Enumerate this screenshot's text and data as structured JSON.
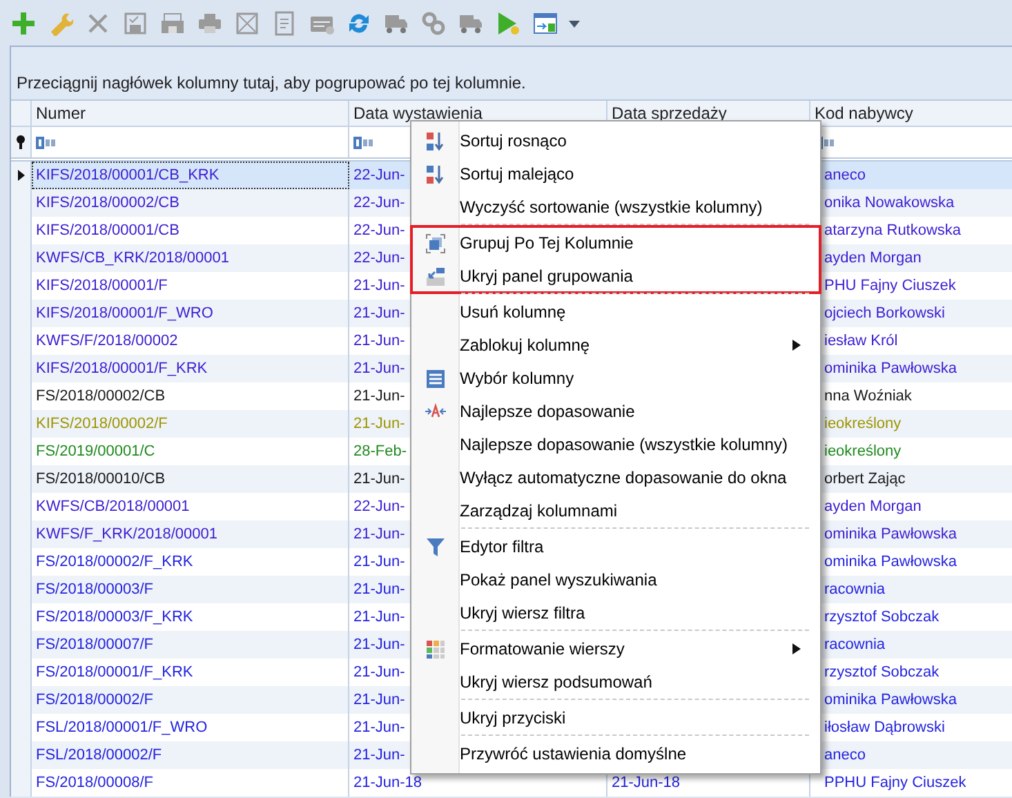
{
  "toolbar": [
    {
      "kind": "add",
      "disabled": false
    },
    {
      "kind": "edit",
      "disabled": false
    },
    {
      "kind": "delete",
      "disabled": true
    },
    {
      "kind": "save",
      "disabled": true
    },
    {
      "kind": "saveall",
      "disabled": true
    },
    {
      "kind": "print",
      "disabled": true
    },
    {
      "kind": "cancel",
      "disabled": true
    },
    {
      "kind": "document",
      "disabled": true
    },
    {
      "kind": "card",
      "disabled": true
    },
    {
      "kind": "refresh",
      "disabled": false
    },
    {
      "kind": "truck",
      "disabled": true
    },
    {
      "kind": "gears",
      "disabled": true
    },
    {
      "kind": "truck",
      "disabled": true
    },
    {
      "kind": "run",
      "disabled": false
    },
    {
      "kind": "export",
      "disabled": false
    }
  ],
  "group_panel": {
    "hint": "Przeciągnij nagłówek kolumny tutaj, aby pogrupować po tej kolumnie."
  },
  "table": {
    "columns": [
      {
        "title": "Numer",
        "filter": true
      },
      {
        "title": "Data wystawienia",
        "filter": true
      },
      {
        "title": "Data sprzedaży"
      },
      {
        "title": "Kod nabywcy",
        "filter": true
      }
    ],
    "rows": [
      {
        "number": "KIFS/2018/00001/CB_KRK",
        "issued": "22-Jun-",
        "buyer": "aneco",
        "color": "#3b1ed2",
        "selected": true
      },
      {
        "number": "KIFS/2018/00002/CB",
        "issued": "22-Jun-",
        "buyer": "onika Nowakowska",
        "color": "#3b1ed2",
        "selected": false
      },
      {
        "number": "KIFS/2018/00001/CB",
        "issued": "22-Jun-",
        "buyer": "atarzyna Rutkowska",
        "color": "#3b1ed2",
        "selected": false
      },
      {
        "number": "KWFS/CB_KRK/2018/00001",
        "issued": "22-Jun-",
        "buyer": "ayden Morgan",
        "color": "#3b1ed2",
        "selected": false
      },
      {
        "number": "KIFS/2018/00001/F",
        "issued": "21-Jun-",
        "buyer": "PHU Fajny Ciuszek",
        "color": "#3b1ed2",
        "selected": false
      },
      {
        "number": "KIFS/2018/00001/F_WRO",
        "issued": "21-Jun-",
        "buyer": "ojciech Borkowski",
        "color": "#3b1ed2",
        "selected": false
      },
      {
        "number": "KWFS/F/2018/00002",
        "issued": "21-Jun-",
        "buyer": "iesław Król",
        "color": "#3b1ed2",
        "selected": false
      },
      {
        "number": "KIFS/2018/00001/F_KRK",
        "issued": "21-Jun-",
        "buyer": "ominika Pawłowska",
        "color": "#3b1ed2",
        "selected": false
      },
      {
        "number": "FS/2018/00002/CB",
        "issued": "21-Jun-",
        "buyer": "nna Woźniak",
        "color": "#1a1a1a",
        "selected": false
      },
      {
        "number": "KIFS/2018/00002/F",
        "issued": "21-Jun-",
        "buyer": "ieokreślony",
        "color": "#9c9600",
        "selected": false
      },
      {
        "number": "FS/2019/00001/C",
        "issued": "28-Feb-",
        "buyer": "ieokreślony",
        "color": "#1f8a1f",
        "selected": false
      },
      {
        "number": "FS/2018/00010/CB",
        "issued": "21-Jun-",
        "buyer": "orbert Zając",
        "color": "#1a1a1a",
        "selected": false
      },
      {
        "number": "KWFS/CB/2018/00001",
        "issued": "22-Jun-",
        "buyer": "ayden Morgan",
        "color": "#3b1ed2",
        "selected": false
      },
      {
        "number": "KWFS/F_KRK/2018/00001",
        "issued": "21-Jun-",
        "buyer": "ominika Pawłowska",
        "color": "#3b1ed2",
        "selected": false
      },
      {
        "number": "FS/2018/00002/F_KRK",
        "issued": "21-Jun-",
        "buyer": "ominika Pawłowska",
        "color": "#2323e0",
        "selected": false
      },
      {
        "number": "FS/2018/00003/F",
        "issued": "21-Jun-",
        "buyer": "racownia",
        "color": "#2323e0",
        "selected": false
      },
      {
        "number": "FS/2018/00003/F_KRK",
        "issued": "21-Jun-",
        "buyer": "rzysztof Sobczak",
        "color": "#2323e0",
        "selected": false
      },
      {
        "number": "FS/2018/00007/F",
        "issued": "21-Jun-",
        "buyer": "racownia",
        "color": "#2323e0",
        "selected": false
      },
      {
        "number": "FS/2018/00001/F_KRK",
        "issued": "21-Jun-",
        "buyer": "rzysztof Sobczak",
        "color": "#2323e0",
        "selected": false
      },
      {
        "number": "FS/2018/00002/F",
        "issued": "21-Jun-",
        "buyer": "ominika Pawłowska",
        "color": "#2323e0",
        "selected": false
      },
      {
        "number": "FSL/2018/00001/F_WRO",
        "issued": "21-Jun-",
        "buyer": "iłosław Dąbrowski",
        "color": "#2323e0",
        "selected": false
      },
      {
        "number": "FSL/2018/00002/F",
        "issued": "21-Jun-",
        "buyer": "aneco",
        "color": "#2323e0",
        "selected": false
      },
      {
        "number": "FS/2018/00008/F",
        "issued": "21-Jun-18",
        "sold": "21-Jun-18",
        "buyer": "PPHU Fajny Ciuszek",
        "color": "#2323e0",
        "selected": false
      }
    ]
  },
  "context_menu": {
    "groups": [
      {
        "highlighted": false,
        "items": [
          {
            "label": "Sortuj rosnąco",
            "kind": "ascending",
            "submenu": false
          },
          {
            "label": "Sortuj malejąco",
            "kind": "descending",
            "submenu": false
          },
          {
            "label": "Wyczyść sortowanie (wszystkie kolumny)",
            "kind": "plain",
            "submenu": false
          }
        ]
      },
      {
        "highlighted": true,
        "items": [
          {
            "label": "Grupuj Po Tej Kolumnie",
            "kind": "group",
            "submenu": false
          },
          {
            "label": "Ukryj panel grupowania",
            "kind": "hidepanel",
            "submenu": false
          }
        ]
      },
      {
        "highlighted": false,
        "items": [
          {
            "label": "Usuń kolumnę",
            "kind": "plain",
            "submenu": false
          },
          {
            "label": "Zablokuj kolumnę",
            "kind": "plain",
            "submenu": true
          },
          {
            "label": "Wybór kolumny",
            "kind": "columns",
            "submenu": false
          },
          {
            "label": "Najlepsze dopasowanie",
            "kind": "bestfit",
            "submenu": false
          },
          {
            "label": "Najlepsze dopasowanie (wszystkie kolumny)",
            "kind": "plain",
            "submenu": false
          },
          {
            "label": "Wyłącz automatyczne dopasowanie do okna",
            "kind": "plain",
            "submenu": false
          },
          {
            "label": "Zarządzaj kolumnami",
            "kind": "plain",
            "submenu": false
          }
        ]
      },
      {
        "highlighted": false,
        "items": [
          {
            "label": "Edytor filtra",
            "kind": "filter",
            "submenu": false
          },
          {
            "label": "Pokaż panel wyszukiwania",
            "kind": "plain",
            "submenu": false
          },
          {
            "label": "Ukryj wiersz filtra",
            "kind": "plain",
            "submenu": false
          }
        ]
      },
      {
        "highlighted": false,
        "items": [
          {
            "label": "Formatowanie wierszy",
            "kind": "formatting",
            "submenu": true
          },
          {
            "label": "Ukryj wiersz podsumowań",
            "kind": "plain",
            "submenu": false
          }
        ]
      },
      {
        "highlighted": false,
        "items": [
          {
            "label": "Ukryj przyciski",
            "kind": "plain",
            "submenu": false
          }
        ]
      },
      {
        "highlighted": false,
        "items": [
          {
            "label": "Przywróć ustawienia domyślne",
            "kind": "plain",
            "submenu": false
          }
        ]
      }
    ]
  }
}
